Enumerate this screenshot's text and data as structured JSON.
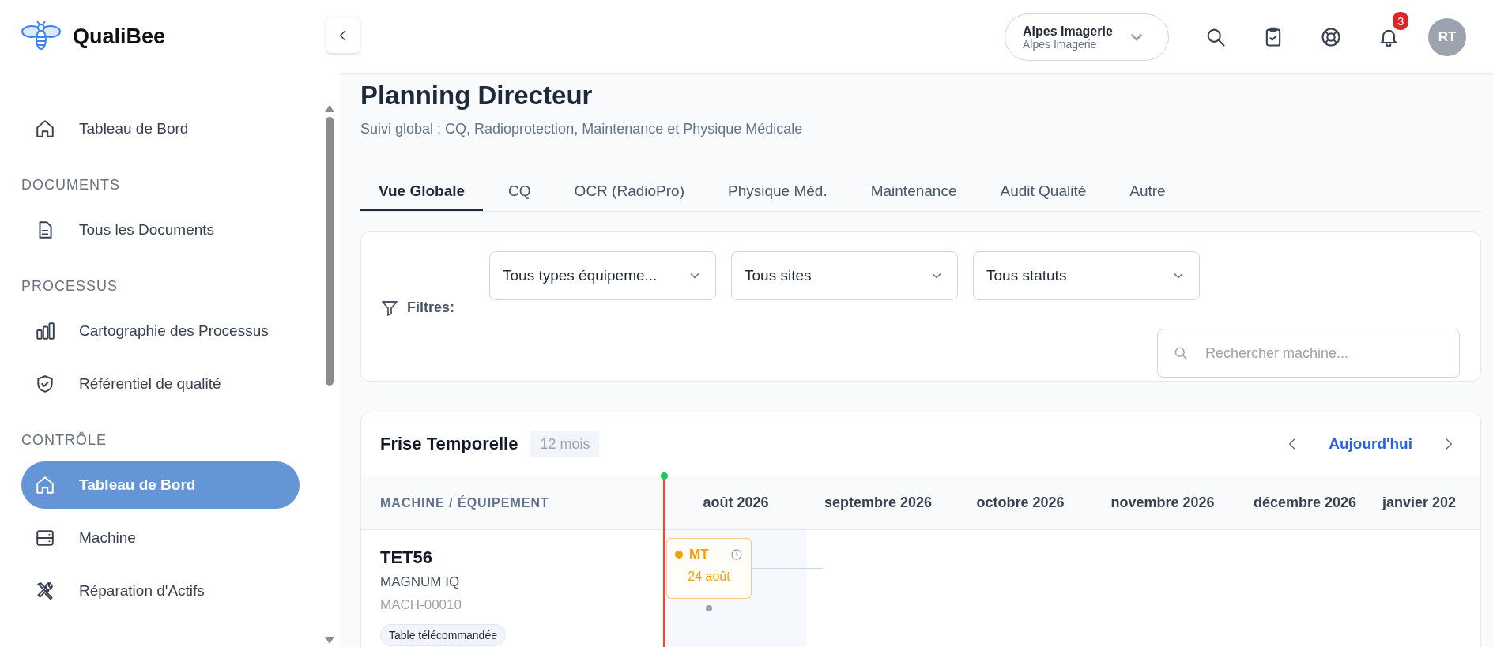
{
  "app": {
    "name": "QualiBee"
  },
  "sidebar": {
    "sections": [
      {
        "items": [
          {
            "label": "Tableau de Bord",
            "selected": false
          }
        ]
      },
      {
        "title": "DOCUMENTS",
        "items": [
          {
            "label": "Tous les Documents",
            "selected": false
          }
        ]
      },
      {
        "title": "PROCESSUS",
        "items": [
          {
            "label": "Cartographie des Processus",
            "selected": false
          },
          {
            "label": "Référentiel de qualité",
            "selected": false
          }
        ]
      },
      {
        "title": "CONTRÔLE",
        "items": [
          {
            "label": "Tableau de Bord",
            "selected": true
          },
          {
            "label": "Machine",
            "selected": false
          },
          {
            "label": "Réparation d'Actifs",
            "selected": false
          }
        ]
      }
    ]
  },
  "topbar": {
    "company": {
      "name": "Alpes Imagerie",
      "subtitle": "Alpes Imagerie"
    },
    "notifications": {
      "count": "3"
    },
    "avatar": {
      "initials": "RT"
    }
  },
  "page": {
    "title": "Planning Directeur",
    "subtitle": "Suivi global : CQ, Radioprotection, Maintenance et Physique Médicale"
  },
  "tabs": [
    {
      "label": "Vue Globale",
      "selected": true
    },
    {
      "label": "CQ",
      "selected": false
    },
    {
      "label": "OCR (RadioPro)",
      "selected": false
    },
    {
      "label": "Physique Méd.",
      "selected": false
    },
    {
      "label": "Maintenance",
      "selected": false
    },
    {
      "label": "Audit Qualité",
      "selected": false
    },
    {
      "label": "Autre",
      "selected": false
    }
  ],
  "filters": {
    "label": "Filtres:",
    "selects": [
      {
        "value": "Tous types équipeme..."
      },
      {
        "value": "Tous sites"
      },
      {
        "value": "Tous statuts"
      }
    ],
    "search": {
      "placeholder": "Rechercher machine..."
    }
  },
  "timeline": {
    "title": "Frise Temporelle",
    "range": "12 mois",
    "today_button": "Aujourd'hui",
    "column_header": "MACHINE / ÉQUIPEMENT",
    "months": [
      "août 2026",
      "septembre 2026",
      "octobre 2026",
      "novembre 2026",
      "décembre 2026",
      "janvier 202"
    ],
    "rows": [
      {
        "name": "TET56",
        "model": "MAGNUM IQ",
        "code": "MACH-00010",
        "tag": "Table télécommandée",
        "events": [
          {
            "label": "MT",
            "date": "24 août",
            "color": "#f59e0b"
          }
        ]
      }
    ]
  }
}
